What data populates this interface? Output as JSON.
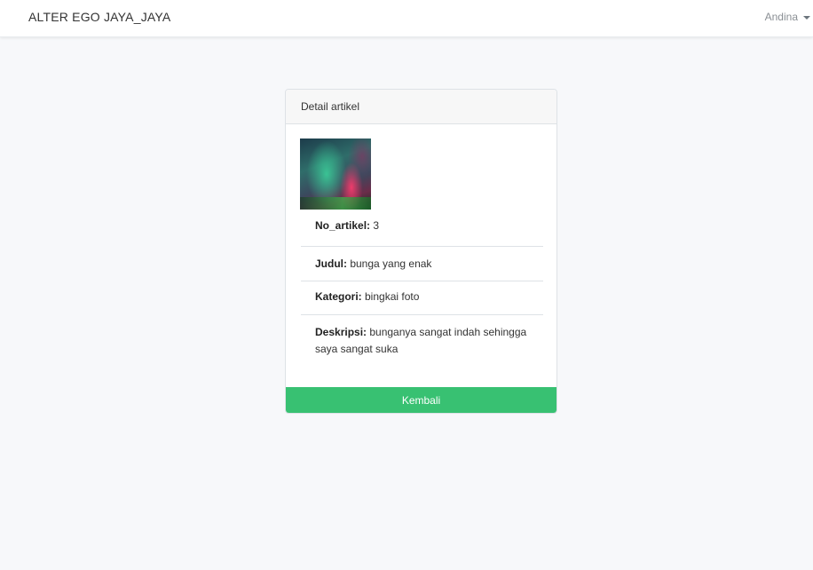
{
  "navbar": {
    "brand": "ALTER EGO JAYA_JAYA",
    "user": "Andina"
  },
  "card": {
    "header": "Detail artikel",
    "image_icon": "article-image",
    "fields": [
      {
        "label": "No_artikel:",
        "value": " 3"
      },
      {
        "label": "Judul:",
        "value": " bunga yang enak"
      },
      {
        "label": "Kategori:",
        "value": " bingkai foto"
      },
      {
        "label": "Deskripsi:",
        "value": " bunganya sangat indah sehingga saya sangat suka"
      }
    ],
    "back_label": "Kembali"
  },
  "colors": {
    "button": "#38c172",
    "page_bg": "#f7f8fa"
  }
}
